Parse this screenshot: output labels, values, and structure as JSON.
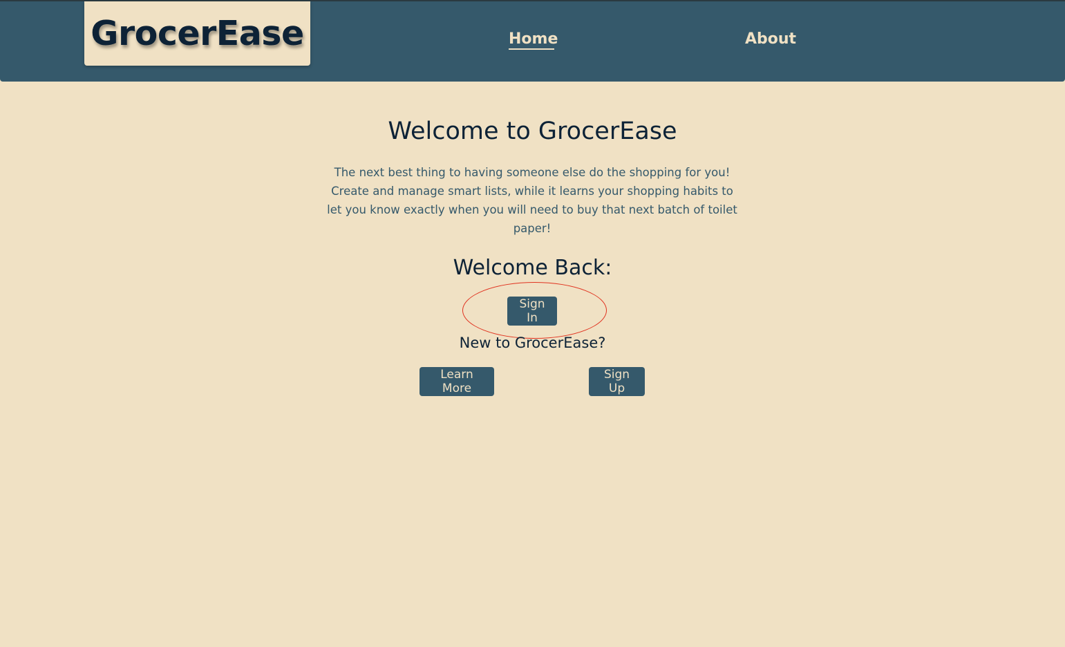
{
  "header": {
    "logo": "GrocerEase",
    "nav": {
      "home": "Home",
      "about": "About"
    }
  },
  "main": {
    "title": "Welcome to GrocerEase",
    "intro": "The next best thing to having someone else do the shopping for you! Create and manage smart lists, while it learns your shopping habits to let you know exactly when you will need to buy that next batch of toilet paper!",
    "welcome_back": "Welcome Back:",
    "sign_in_label": "Sign In",
    "new_to": "New to GrocerEase?",
    "learn_more_label": "Learn More",
    "sign_up_label": "Sign Up"
  },
  "colors": {
    "background": "#f0e1c4",
    "header": "#35596b",
    "button": "#35596b",
    "heading_text": "#0d2236",
    "highlight": "#e0321f"
  }
}
